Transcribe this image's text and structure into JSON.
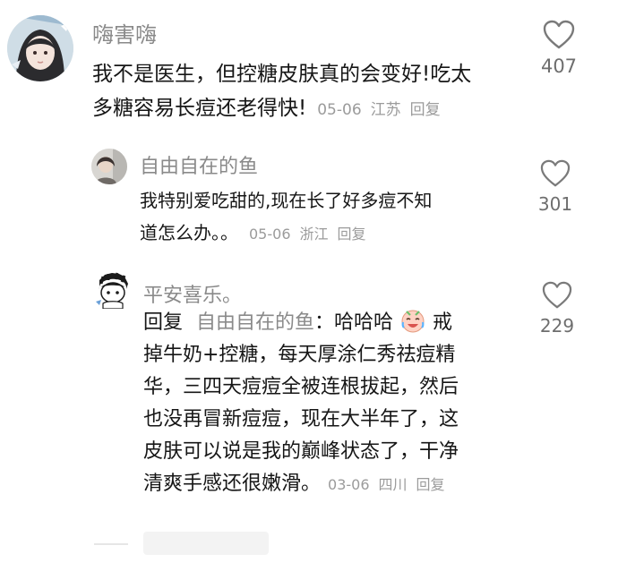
{
  "comments": [
    {
      "username": "嗨害嗨",
      "text_line1": "我不是医生，但控糖皮肤真的会变好!吃太",
      "text_line2": "多糖容易长痘还老得快!",
      "date": "05-06",
      "location": "江苏",
      "reply_label": "回复",
      "likes": "407",
      "avatar_icon": "girl-avatar"
    },
    {
      "username": "自由自在的鱼",
      "text_line1": "我特别爱吃甜的,现在长了好多痘不知",
      "text_line2": "道怎么办。。",
      "date": "05-06",
      "location": "浙江",
      "reply_label": "回复",
      "likes": "301",
      "avatar_icon": "selfie-avatar"
    },
    {
      "username": "平安喜乐。",
      "reply_prefix": "回复",
      "mention": "自由自在的鱼",
      "line1_tail": "：哈哈哈",
      "line1_end": "戒",
      "line2": "掉牛奶+控糖，每天厚涂仁秀祛痘精",
      "line3": "华，三四天痘痘全被连根拔起，然后",
      "line4": "也没再冒新痘痘，现在大半年了，这",
      "line5": "皮肤可以说是我的巅峰状态了，干净",
      "line6": "清爽手感还很嫩滑。",
      "date": "03-06",
      "location": "四川",
      "reply_label": "回复",
      "likes": "229",
      "avatar_icon": "cartoon-avatar",
      "emoji_icon": "laughing-crying-emoji"
    }
  ],
  "colors": {
    "username": "#8a8a8a",
    "text": "#161616",
    "meta": "#9b9b9b",
    "heart_stroke": "#7a7a7a"
  }
}
